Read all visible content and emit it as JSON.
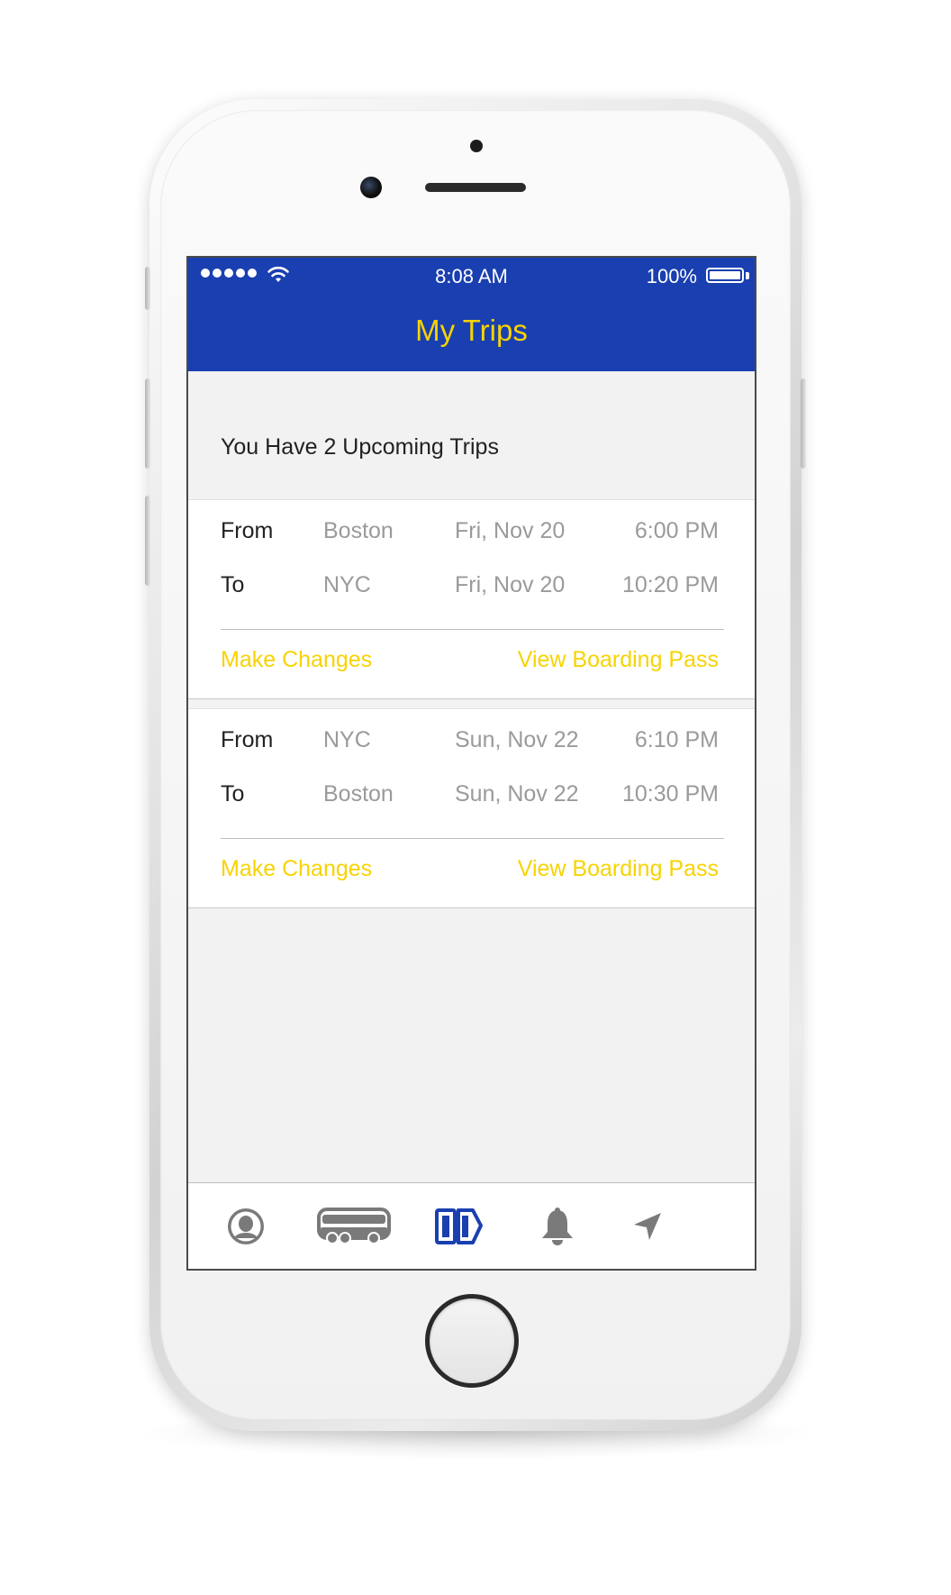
{
  "colors": {
    "header_bg": "#1a3fb1",
    "accent_yellow": "#f7d302",
    "active_tab": "#1a3fb1",
    "inactive_tab": "#7a7a7a"
  },
  "status_bar": {
    "time": "8:08 AM",
    "battery": "100%"
  },
  "header": {
    "title": "My Trips"
  },
  "summary": "You Have 2 Upcoming Trips",
  "trips": [
    {
      "from": {
        "label": "From",
        "city": "Boston",
        "date": "Fri, Nov 20",
        "time": "6:00 PM"
      },
      "to": {
        "label": "To",
        "city": "NYC",
        "date": "Fri, Nov 20",
        "time": "10:20 PM"
      },
      "make_changes": "Make Changes",
      "view_pass": "View Boarding Pass"
    },
    {
      "from": {
        "label": "From",
        "city": "NYC",
        "date": "Sun, Nov 22",
        "time": "6:10 PM"
      },
      "to": {
        "label": "To",
        "city": "Boston",
        "date": "Sun, Nov 22",
        "time": "10:30 PM"
      },
      "make_changes": "Make Changes",
      "view_pass": "View Boarding Pass"
    }
  ],
  "tabs": [
    {
      "icon": "profile-icon",
      "active": false
    },
    {
      "icon": "bus-icon",
      "active": false
    },
    {
      "icon": "tickets-icon",
      "active": true
    },
    {
      "icon": "bell-icon",
      "active": false
    },
    {
      "icon": "location-arrow-icon",
      "active": false
    }
  ]
}
